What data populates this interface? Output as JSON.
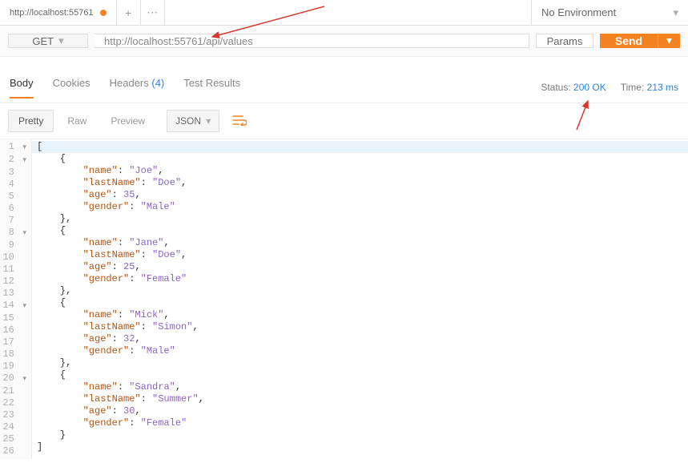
{
  "tab": {
    "title": "http://localhost:55761"
  },
  "environment": {
    "label": "No Environment"
  },
  "request": {
    "method": "GET",
    "url": "http://localhost:55761/api/values",
    "params_label": "Params",
    "send_label": "Send"
  },
  "response_tabs": {
    "body": "Body",
    "cookies": "Cookies",
    "headers": "Headers",
    "headers_count": "(4)",
    "tests": "Test Results"
  },
  "status": {
    "status_label": "Status:",
    "status_value": "200 OK",
    "time_label": "Time:",
    "time_value": "213 ms"
  },
  "body_toolbar": {
    "pretty": "Pretty",
    "raw": "Raw",
    "preview": "Preview",
    "format": "JSON"
  },
  "response_json": [
    {
      "name": "Joe",
      "lastName": "Doe",
      "age": 35,
      "gender": "Male"
    },
    {
      "name": "Jane",
      "lastName": "Doe",
      "age": 25,
      "gender": "Female"
    },
    {
      "name": "Mick",
      "lastName": "Simon",
      "age": 32,
      "gender": "Male"
    },
    {
      "name": "Sandra",
      "lastName": "Summer",
      "age": 30,
      "gender": "Female"
    }
  ]
}
